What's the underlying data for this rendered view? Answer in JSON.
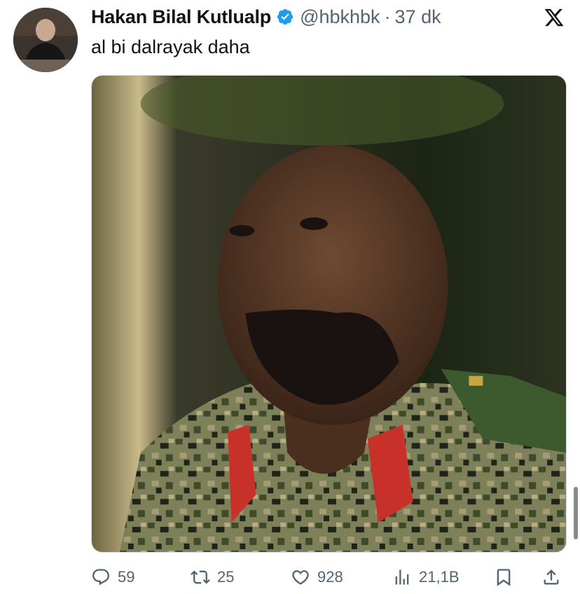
{
  "author": {
    "name": "Hakan Bilal Kutlualp",
    "handle": "@hbkhbk",
    "separator": "·",
    "time": "37 dk",
    "verified_color": "#1d9bf0"
  },
  "tweet": {
    "text": "al bi dalrayak daha"
  },
  "actions": {
    "replies": "59",
    "reposts": "25",
    "likes": "928",
    "views": "21,1B"
  },
  "colors": {
    "text_primary": "#0f1419",
    "text_secondary": "#536471"
  },
  "icons": [
    "x-logo-icon",
    "verified-badge-icon",
    "reply-icon",
    "repost-icon",
    "like-icon",
    "views-icon",
    "bookmark-icon",
    "share-icon"
  ]
}
